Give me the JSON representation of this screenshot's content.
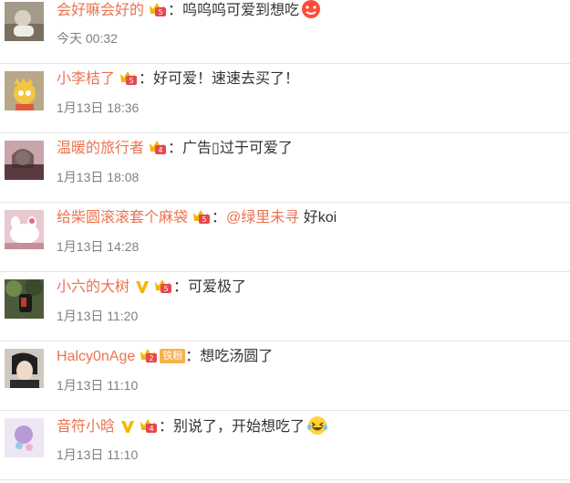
{
  "comments": [
    {
      "user": "会好嘛会好的",
      "colon": "：",
      "text": "呜呜呜可爱到想吃",
      "time": "今天 00:32",
      "emoji": "face-emoji-red"
    },
    {
      "user": "小李桔了",
      "colon": "：",
      "text": "好可爱！速速去买了！",
      "time": "1月13日 18:36"
    },
    {
      "user": "温暖的旅行者",
      "colon": "：",
      "text": "广告▯过于可爱了",
      "time": "1月13日 18:08"
    },
    {
      "user": "给柴圆滚滚套个麻袋",
      "colon": "：",
      "mention": "@绿里未寻",
      "text": " 好koi",
      "time": "1月13日 14:28"
    },
    {
      "user": "小六的大树",
      "colon": "：",
      "text": "可爱极了",
      "time": "1月13日 11:20",
      "verified": true
    },
    {
      "user": "Halcy0nAge",
      "colon": "：",
      "text": "想吃汤圆了",
      "time": "1月13日 11:10",
      "fan_badge": "铁粉"
    },
    {
      "user": "音符小晗",
      "colon": "：",
      "text": "别说了，开始想吃了",
      "time": "1月13日 11:10",
      "verified": true,
      "emoji": "laughing-tears-emoji"
    }
  ],
  "icons": {
    "crown_badge": "crown-badge-icon",
    "verified": "verified-v-icon"
  },
  "colors": {
    "username": "#eb7350",
    "time": "#808080",
    "text": "#333333",
    "divider": "#e6e6e6",
    "vip_badge": "#f7b500"
  }
}
